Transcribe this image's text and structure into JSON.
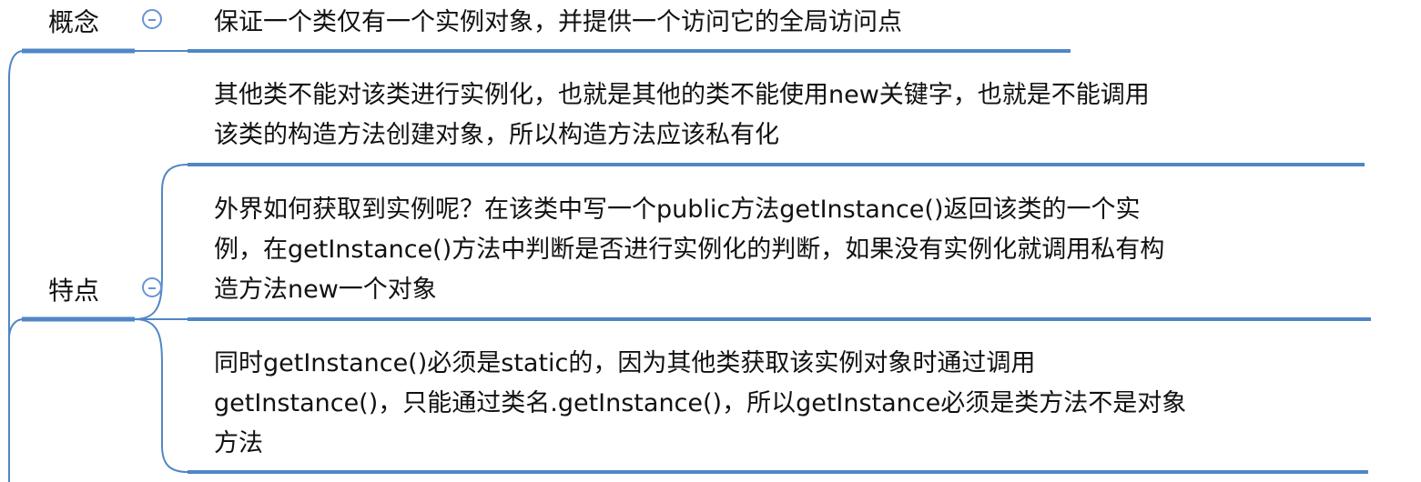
{
  "mindmap": {
    "accent_color": "#4f86c6",
    "branches": [
      {
        "label": "概念",
        "toggle_icon": "collapse-minus-icon",
        "items": [
          {
            "lines": [
              "保证一个类仅有一个实例对象，并提供一个访问它的全局访问点"
            ]
          }
        ]
      },
      {
        "label": "特点",
        "toggle_icon": "collapse-minus-icon",
        "items": [
          {
            "lines": [
              "其他类不能对该类进行实例化，也就是其他的类不能使用new关键字，也就是不能调用",
              "该类的构造方法创建对象，所以构造方法应该私有化"
            ]
          },
          {
            "lines": [
              "外界如何获取到实例呢？在该类中写一个public方法getInstance()返回该类的一个实",
              "例，在getInstance()方法中判断是否进行实例化的判断，如果没有实例化就调用私有构",
              "造方法new一个对象"
            ]
          },
          {
            "lines": [
              "同时getInstance()必须是static的，因为其他类获取该实例对象时通过调用",
              "getInstance()，只能通过类名.getInstance()，所以getInstance必须是类方法不是对象",
              "方法"
            ]
          }
        ]
      }
    ]
  }
}
